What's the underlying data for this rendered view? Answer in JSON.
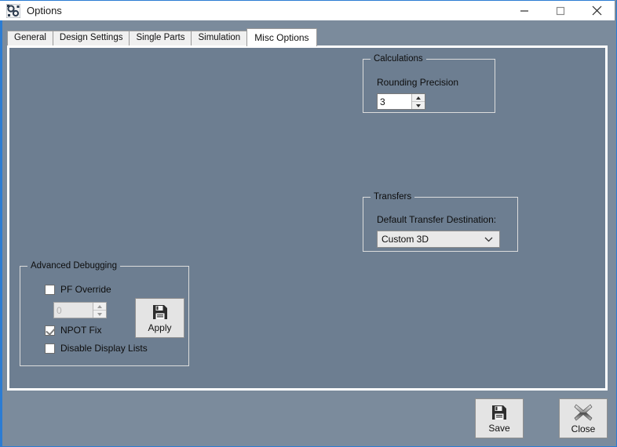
{
  "window": {
    "title": "Options",
    "icon": "app-gears-icon",
    "controls": {
      "minimize": "minimize-icon",
      "maximize": "maximize-icon",
      "close": "close-icon"
    },
    "accent_color": "#2b7cd3",
    "titlebar_bg": "#ffffff"
  },
  "tabs": [
    {
      "label": "General",
      "active": false
    },
    {
      "label": "Design Settings",
      "active": false
    },
    {
      "label": "Single Parts",
      "active": false
    },
    {
      "label": "Simulation",
      "active": false
    },
    {
      "label": "Misc Options",
      "active": true
    }
  ],
  "panel": {
    "bg_color": "#6d7e91",
    "border_color": "#ffffff"
  },
  "groups": {
    "calculations": {
      "title": "Calculations",
      "rounding_precision": {
        "label": "Rounding Precision",
        "value": "3",
        "enabled": true
      }
    },
    "transfers": {
      "title": "Transfers",
      "default_transfer_destination": {
        "label": "Default Transfer Destination:",
        "value": "Custom 3D"
      }
    },
    "advanced_debugging": {
      "title": "Advanced Debugging",
      "pf_override": {
        "label": "PF Override",
        "checked": false
      },
      "pf_override_value": {
        "value": "0",
        "enabled": false
      },
      "npot_fix": {
        "label": "NPOT Fix",
        "checked": true
      },
      "disable_display_lists": {
        "label": "Disable Display Lists",
        "checked": false
      },
      "apply_button": {
        "label": "Apply",
        "icon": "floppy-disk-save-icon"
      }
    }
  },
  "footer": {
    "save_button": {
      "label": "Save",
      "icon": "floppy-disk-save-icon"
    },
    "close_button": {
      "label": "Close",
      "icon": "x-mark-icon"
    }
  }
}
